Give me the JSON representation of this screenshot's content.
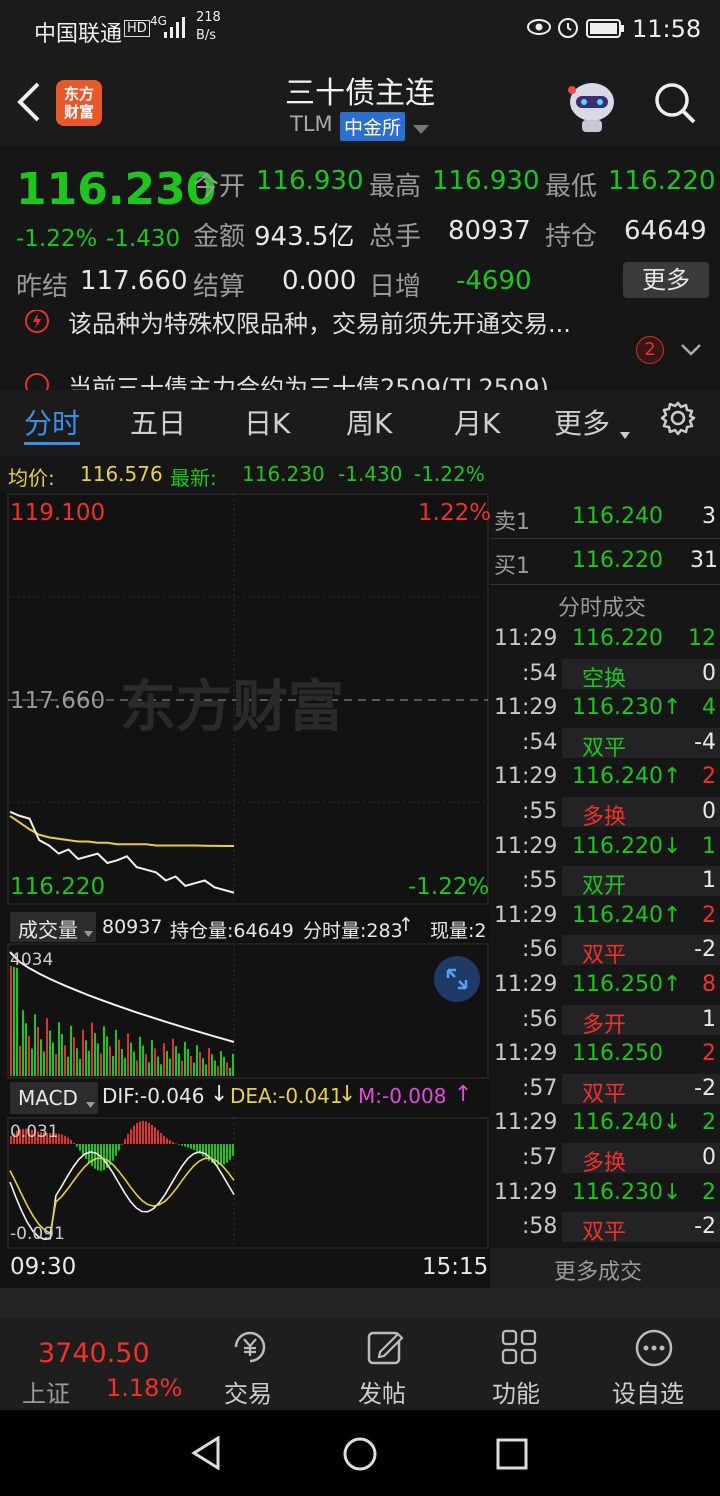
{
  "status_bar": {
    "carrier": "中国联通",
    "hd": "HD",
    "net": "4G",
    "speed_top": "218",
    "speed_bottom": "B/s",
    "time": "11:58"
  },
  "header": {
    "logo": "东方\n财富",
    "title": "三十债主连",
    "code": "TLM",
    "exchange": "中金所"
  },
  "quote": {
    "price": "116.230",
    "pct": "-1.22%",
    "chg": "-1.430",
    "open_label": "今开",
    "open": "116.930",
    "high_label": "最高",
    "high": "116.930",
    "low_label": "最低",
    "low": "116.220",
    "amount_label": "金额",
    "amount": "943.5亿",
    "vol_label": "总手",
    "vol": "80937",
    "oi_label": "持仓",
    "oi": "64649",
    "prev_label": "昨结",
    "prev": "117.660",
    "settle_label": "结算",
    "settle": "0.000",
    "daily_label": "日增",
    "daily": "-4690",
    "more_label": "更多"
  },
  "alerts": {
    "line1": "该品种为特殊权限品种，交易前须先开通交易...",
    "line2": "当前三十债主力合约为三十债2509(TL2509)",
    "badge": "2"
  },
  "tabs": [
    "分时",
    "五日",
    "日K",
    "周K",
    "月K",
    "更多"
  ],
  "infobar": {
    "avg_label": "均价:",
    "avg": "116.576",
    "latest_label": "最新:",
    "latest": "116.230",
    "chg": "-1.430",
    "pct": "-1.22%"
  },
  "chart": {
    "y_top": "119.100",
    "y_top_pct": "1.22%",
    "y_mid": "117.660",
    "y_bot": "116.220",
    "y_bot_pct": "-1.22%",
    "watermark": "东方财富",
    "vol_tab": "成交量",
    "vol_total": "80937",
    "oi_text": "持仓量:64649",
    "minute_vol": "分时量:283",
    "now_vol": "现量:2",
    "vol_max": "4034",
    "macd_tab": "MACD",
    "dif": "DIF:-0.046",
    "dea": "DEA:-0.041",
    "m": "M:-0.008",
    "macd_top": "0.031",
    "macd_bot": "-0.091",
    "t_start": "09:30",
    "t_end": "15:15"
  },
  "chart_data": {
    "type": "line",
    "price_series": [
      116.83,
      116.8,
      116.78,
      116.62,
      116.58,
      116.52,
      116.55,
      116.48,
      116.5,
      116.52,
      116.45,
      116.47,
      116.5,
      116.42,
      116.4,
      116.38,
      116.32,
      116.35,
      116.28,
      116.3,
      116.32,
      116.27,
      116.25,
      116.23
    ],
    "avg_series": [
      116.8,
      116.75,
      116.7,
      116.66,
      116.64,
      116.63,
      116.62,
      116.61,
      116.61,
      116.6,
      116.6,
      116.59,
      116.59,
      116.59,
      116.59,
      116.58,
      116.58,
      116.58,
      116.58,
      116.58,
      116.578,
      116.577,
      116.576,
      116.576
    ],
    "ylim": [
      116.22,
      119.1
    ],
    "prev_settle": 117.66
  },
  "orderbook": {
    "sell1_label": "卖1",
    "sell1_price": "116.240",
    "sell1_vol": "3",
    "buy1_label": "买1",
    "buy1_price": "116.220",
    "buy1_vol": "31",
    "ticks_title": "分时成交",
    "rows": [
      {
        "t": "11:29",
        "p": "116.220",
        "v": "12",
        "pc": "g",
        "vc": "g"
      },
      {
        "t": ":54",
        "p": "空换",
        "v": "0",
        "pc": "g",
        "vc": "gy",
        "tag": true
      },
      {
        "t": "11:29",
        "p": "116.230↑",
        "v": "4",
        "pc": "g",
        "vc": "g"
      },
      {
        "t": ":54",
        "p": "双平",
        "v": "-4",
        "pc": "g",
        "vc": "gy",
        "tag": true
      },
      {
        "t": "11:29",
        "p": "116.240↑",
        "v": "2",
        "pc": "g",
        "vc": "r"
      },
      {
        "t": ":55",
        "p": "多换",
        "v": "0",
        "pc": "r",
        "vc": "gy",
        "tag": true
      },
      {
        "t": "11:29",
        "p": "116.220↓",
        "v": "1",
        "pc": "g",
        "vc": "g"
      },
      {
        "t": ":55",
        "p": "双开",
        "v": "1",
        "pc": "g",
        "vc": "gy",
        "tag": true
      },
      {
        "t": "11:29",
        "p": "116.240↑",
        "v": "2",
        "pc": "g",
        "vc": "r"
      },
      {
        "t": ":56",
        "p": "双平",
        "v": "-2",
        "pc": "r",
        "vc": "gy",
        "tag": true
      },
      {
        "t": "11:29",
        "p": "116.250↑",
        "v": "8",
        "pc": "g",
        "vc": "r"
      },
      {
        "t": ":56",
        "p": "多开",
        "v": "1",
        "pc": "r",
        "vc": "gy",
        "tag": true
      },
      {
        "t": "11:29",
        "p": "116.250",
        "v": "2",
        "pc": "g",
        "vc": "r"
      },
      {
        "t": ":57",
        "p": "双平",
        "v": "-2",
        "pc": "r",
        "vc": "gy",
        "tag": true
      },
      {
        "t": "11:29",
        "p": "116.240↓",
        "v": "2",
        "pc": "g",
        "vc": "g"
      },
      {
        "t": ":57",
        "p": "多换",
        "v": "0",
        "pc": "r",
        "vc": "gy",
        "tag": true
      },
      {
        "t": "11:29",
        "p": "116.230↓",
        "v": "2",
        "pc": "g",
        "vc": "g"
      },
      {
        "t": ":58",
        "p": "双平",
        "v": "-2",
        "pc": "r",
        "vc": "gy",
        "tag": true
      }
    ],
    "more_label": "更多成交"
  },
  "bottom": {
    "index_value": "3740.50",
    "index_name": "上证",
    "index_pct": "1.18%",
    "trade": "交易",
    "post": "发帖",
    "func": "功能",
    "watch": "设自选"
  }
}
